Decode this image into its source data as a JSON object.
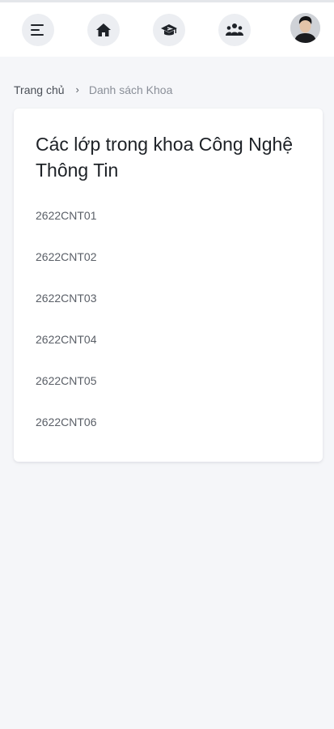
{
  "header": {
    "nav": [
      {
        "icon": "menu-icon"
      },
      {
        "icon": "home-icon"
      },
      {
        "icon": "graduation-cap-icon"
      },
      {
        "icon": "users-icon"
      }
    ],
    "avatar": {
      "icon": "user-avatar"
    }
  },
  "breadcrumb": {
    "home": "Trang chủ",
    "separator": "›",
    "current": "Danh sách Khoa"
  },
  "main": {
    "title": "Các lớp trong khoa Công Nghệ Thông Tin",
    "classes": [
      "2622CNT01",
      "2622CNT02",
      "2622CNT03",
      "2622CNT04",
      "2622CNT05",
      "2622CNT06"
    ]
  },
  "colors": {
    "background": "#f5f6f9",
    "card": "#ffffff",
    "icon": "#1f2329",
    "icon_bg": "#eceef2"
  }
}
